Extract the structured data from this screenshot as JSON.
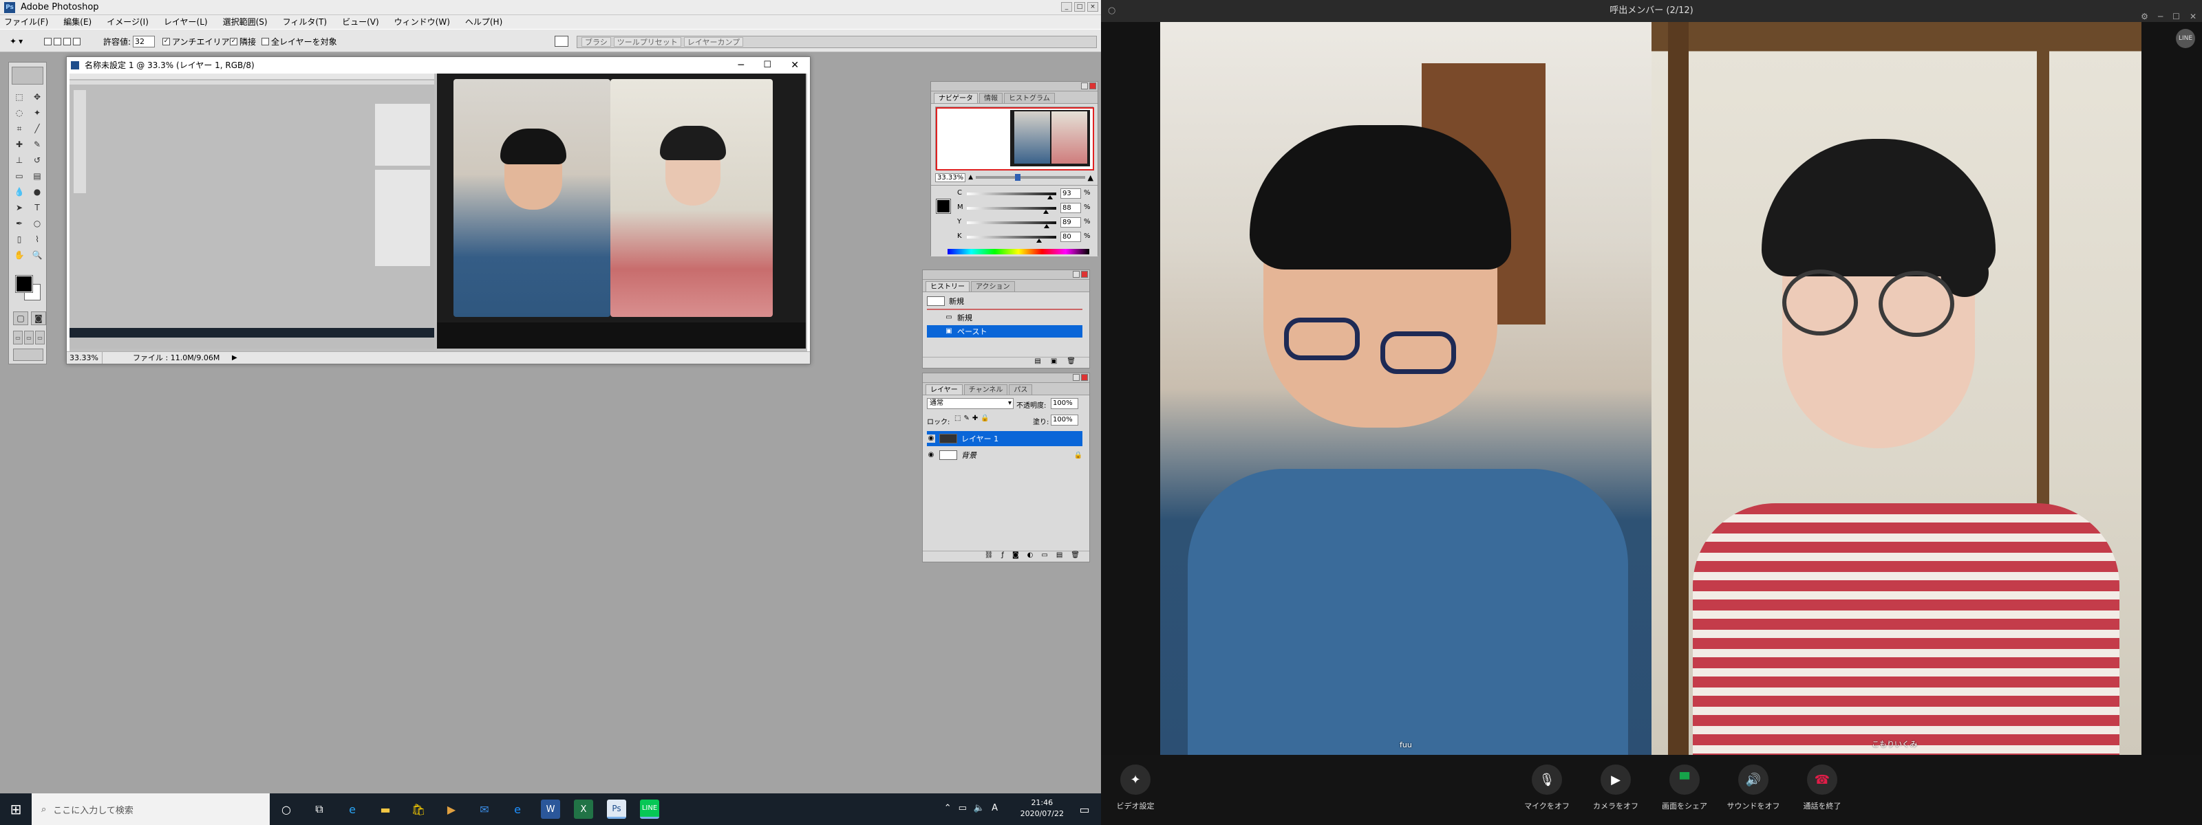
{
  "photoshop": {
    "title": "Adobe Photoshop",
    "app_icon": "Ps",
    "window_buttons": [
      "_",
      "□",
      "×"
    ],
    "menu": [
      "ファイル(F)",
      "編集(E)",
      "イメージ(I)",
      "レイヤー(L)",
      "選択範囲(S)",
      "フィルタ(T)",
      "ビュー(V)",
      "ウィンドウ(W)",
      "ヘルプ(H)"
    ],
    "options": {
      "tolerance_label": "許容値:",
      "tolerance_value": "32",
      "antialias_label": "アンチエイリアス",
      "contiguous_label": "隣接",
      "all_layers_label": "全レイヤーを対象",
      "well_tabs": [
        "ブラシ",
        "ツールプリセット",
        "レイヤーカンプ"
      ]
    },
    "document": {
      "title": "名称未設定 1 @ 33.3% (レイヤー 1, RGB/8)",
      "zoom": "33.33%",
      "file_info": "ファイル : 11.0M/9.06M"
    },
    "navigator": {
      "tabs": [
        "ナビゲータ",
        "情報",
        "ヒストグラム"
      ],
      "zoom": "33.33%"
    },
    "color": {
      "channels": [
        {
          "label": "C",
          "value": "93",
          "unit": "%",
          "level": 0.93
        },
        {
          "label": "M",
          "value": "88",
          "unit": "%",
          "level": 0.88
        },
        {
          "label": "Y",
          "value": "89",
          "unit": "%",
          "level": 0.89
        },
        {
          "label": "K",
          "value": "80",
          "unit": "%",
          "level": 0.8
        }
      ]
    },
    "history": {
      "tabs": [
        "ヒストリー",
        "アクション"
      ],
      "snapshot": "新規",
      "items": [
        "新規",
        "ペースト"
      ]
    },
    "layers": {
      "tabs": [
        "レイヤー",
        "チャンネル",
        "パス"
      ],
      "blend_mode": "通常",
      "opacity_label": "不透明度:",
      "opacity_value": "100%",
      "lock_label": "ロック:",
      "fill_label": "塗り:",
      "fill_value": "100%",
      "items": [
        "レイヤー 1",
        "背景"
      ]
    }
  },
  "taskbar": {
    "search_placeholder": "ここに入力して検索",
    "time": "21:46",
    "date": "2020/07/22",
    "ime": "A"
  },
  "call": {
    "title": "呼出メンバー (2/12)",
    "participant_1": "fuu",
    "participant_2": "こもりいくみ",
    "controls": {
      "video_settings": "ビデオ設定",
      "mic_off": "マイクをオフ",
      "camera_off": "カメラをオフ",
      "screen_share": "画面をシェア",
      "sound_off": "サウンドをオフ",
      "end_call": "通話を終了"
    }
  },
  "colors": {
    "share_green": "#16a34a",
    "end_red": "#e11d48",
    "selection_blue": "#0a66d8",
    "line_green": "#06c755"
  }
}
